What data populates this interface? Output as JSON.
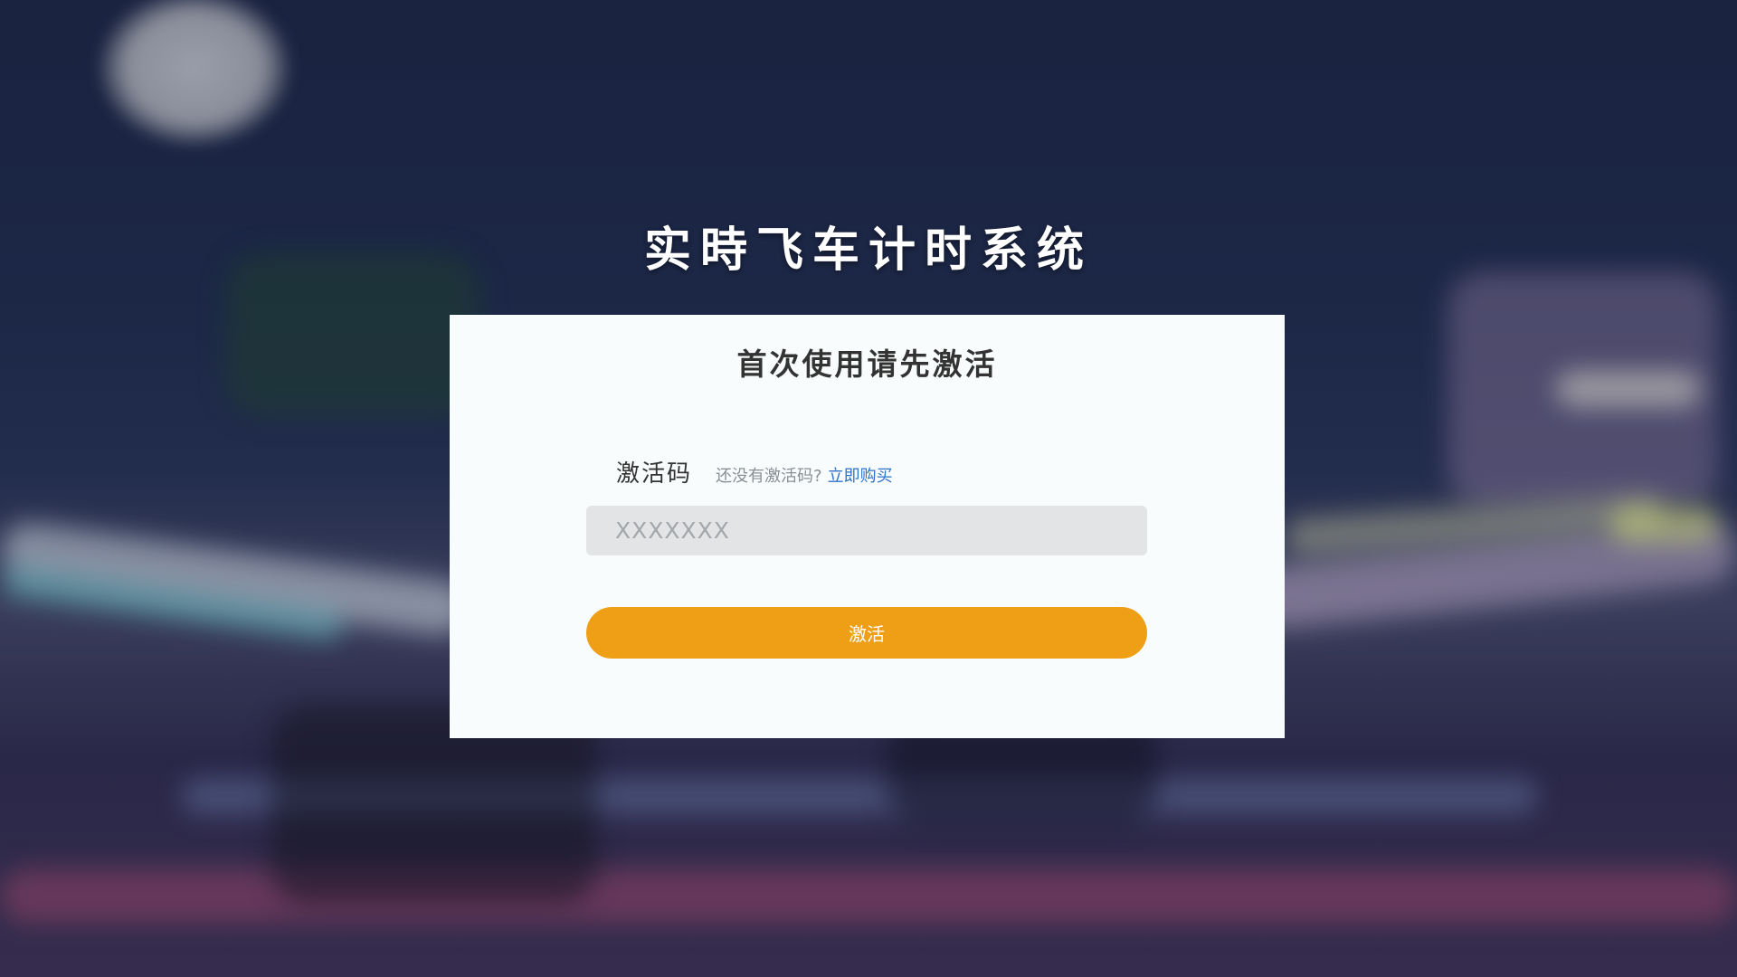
{
  "app": {
    "title": "实時飞车计时系统"
  },
  "activation": {
    "heading": "首次使用请先激活",
    "code_label": "激活码",
    "hint_text": "还没有激活码?",
    "buy_link": "立即购买",
    "code_value": "",
    "code_placeholder": "XXXXXXX",
    "submit_label": "激活"
  },
  "colors": {
    "accent": "#ef9f15",
    "link": "#2f73c8",
    "card_bg": "#f8fcfc",
    "input_bg": "#e2e4e5"
  }
}
